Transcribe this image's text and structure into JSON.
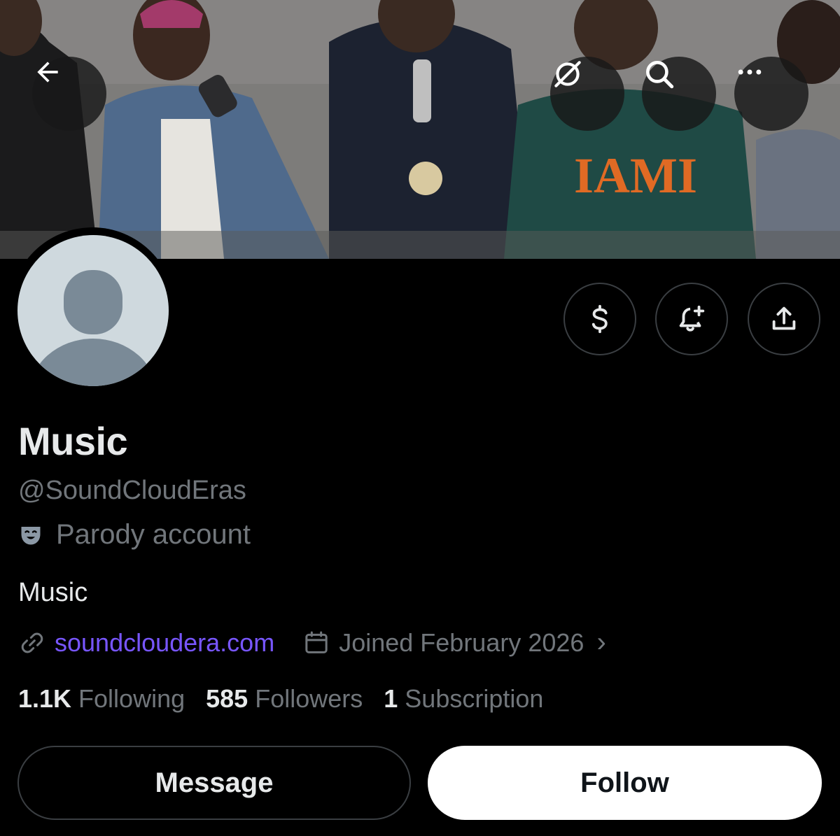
{
  "header": {
    "banner_image": "group-of-rappers-with-microphones",
    "back_icon": "arrow-left-icon",
    "grok_icon": "grok-icon",
    "search_icon": "search-icon",
    "more_icon": "more-horizontal-icon"
  },
  "profile": {
    "avatar": "default-avatar",
    "name": "Music",
    "handle": "@SoundCloudEras",
    "parody_label": "Parody account",
    "bio": "Music",
    "website": "soundcloudera.com",
    "joined": "Joined February 2026",
    "chevron": "›"
  },
  "actions": {
    "subscribe_icon": "dollar-sign-icon",
    "notify_icon": "bell-plus-icon",
    "share_icon": "share-icon"
  },
  "stats": {
    "following_count": "1.1K",
    "following_label": "Following",
    "followers_count": "585",
    "followers_label": "Followers",
    "subscriptions_count": "1",
    "subscriptions_label": "Subscription"
  },
  "buttons": {
    "message_label": "Message",
    "follow_label": "Follow"
  },
  "colors": {
    "background": "#000000",
    "link": "#7856ff",
    "muted": "#71767b",
    "text": "#e7e9ea",
    "border": "#3a3e42"
  }
}
